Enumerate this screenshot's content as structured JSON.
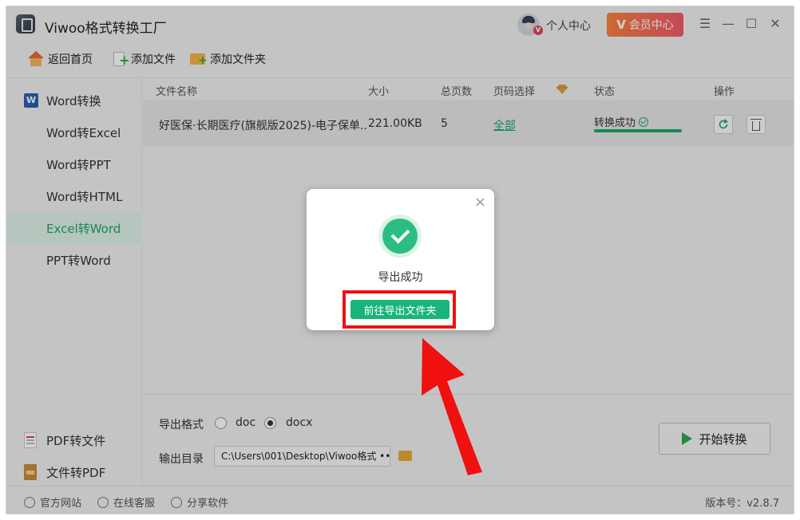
{
  "app": {
    "title": "Viwoo格式转换工厂",
    "user_center": "个人中心",
    "member_center": "会员中心",
    "member_v": "V"
  },
  "window_controls": {
    "menu": "☰",
    "minimize": "—",
    "maximize": "☐",
    "close": "✕"
  },
  "toolbar": {
    "home": "返回首页",
    "add_file": "添加文件",
    "add_folder": "添加文件夹"
  },
  "sidebar": {
    "items": [
      {
        "label": "Word转换",
        "icon": "word-icon"
      },
      {
        "label": "Word转Excel"
      },
      {
        "label": "Word转PPT"
      },
      {
        "label": "Word转HTML"
      },
      {
        "label": "Excel转Word",
        "active": true
      },
      {
        "label": "PPT转Word"
      }
    ],
    "bottom_items": [
      {
        "label": "PDF转文件",
        "icon": "pdf-icon"
      },
      {
        "label": "文件转PDF",
        "icon": "to-pdf-icon"
      }
    ]
  },
  "table": {
    "columns": {
      "name": "文件名称",
      "size": "大小",
      "pages": "总页数",
      "page_select": "页码选择",
      "status": "状态",
      "ops": "操作"
    },
    "rows": [
      {
        "name": "好医保·长期医疗(旗舰版2025)-电子保单....",
        "size": "221.00KB",
        "pages": "5",
        "page_select": "全部",
        "status": "转换成功",
        "progress": 1.0
      }
    ]
  },
  "settings": {
    "format_label": "导出格式",
    "formats": [
      "doc",
      "docx"
    ],
    "selected_format": "docx",
    "output_label": "输出目录",
    "output_path": "C:\\Users\\001\\Desktop\\Viwoo格式 •••",
    "start_button": "开始转换"
  },
  "footer": {
    "website": "官方网站",
    "support": "在线客服",
    "share": "分享软件",
    "version": "版本号：v2.8.7"
  },
  "modal": {
    "close": "×",
    "message": "导出成功",
    "button": "前往导出文件夹"
  },
  "colors": {
    "accent": "#19a86b",
    "member_gradient_start": "#f7823b",
    "member_gradient_end": "#ef5a6f",
    "annotation_red": "#f01010"
  }
}
